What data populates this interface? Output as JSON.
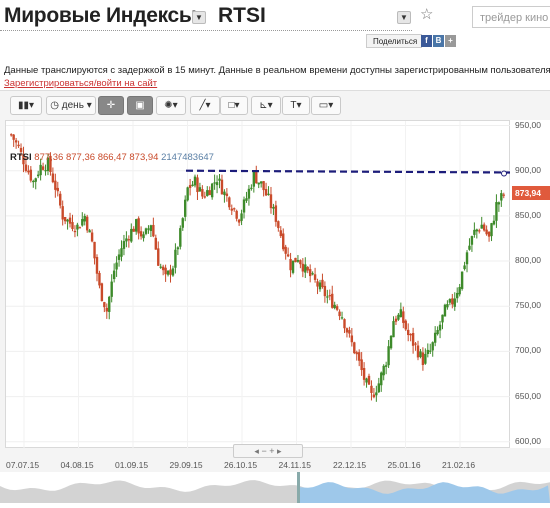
{
  "header": {
    "title": "Мировые Индексы",
    "symbol": "RTSI",
    "search_placeholder": "трейдер кино",
    "share_label": "Поделиться",
    "share_icons": [
      "f",
      "B",
      "+"
    ]
  },
  "notice": {
    "text": "Данные транслируются с задержкой в 15 минут. Данные в реальном времени доступны зарегистрированным пользователям.",
    "link": "Зарегистрироваться/войти на сайт",
    "tail": "."
  },
  "toolbar": {
    "period_label": "день",
    "icons": [
      "candles-icon",
      "clock-icon",
      "crosshair-icon",
      "save-icon",
      "indicators-icon",
      "line-draw-icon",
      "shapes-icon",
      "fibonacci-icon",
      "text-icon",
      "image-icon"
    ]
  },
  "legend": {
    "symbol": "RTSI",
    "open": "877,36",
    "high": "877,36",
    "low": "866,47",
    "close": "873,94",
    "volume": "2147483647"
  },
  "pager": {
    "left": "◂",
    "minus": "−",
    "plus": "+",
    "right": "▸"
  },
  "colors": {
    "up": "#3d8a2a",
    "down": "#c94a2a",
    "trendline": "#1c1c7a",
    "price_tag": "#e05a3c",
    "navigator": "#9ec8ea"
  },
  "chart_data": {
    "type": "candlestick",
    "y_ticks": [
      "950,00",
      "900,00",
      "850,00",
      "800,00",
      "750,00",
      "700,00",
      "650,00",
      "600,00"
    ],
    "x_ticks": [
      "07.07.15",
      "04.08.15",
      "01.09.15",
      "29.09.15",
      "26.10.15",
      "24.11.15",
      "22.12.15",
      "25.01.16",
      "21.02.16"
    ],
    "ylim": [
      592,
      955
    ],
    "current_price": "873,94",
    "trendline": {
      "from": [
        "29.09.15",
        900
      ],
      "to": [
        "end",
        898
      ]
    },
    "close_path": [
      [
        0,
        940
      ],
      [
        3,
        925
      ],
      [
        6,
        905
      ],
      [
        9,
        888
      ],
      [
        12,
        905
      ],
      [
        15,
        908
      ],
      [
        18,
        882
      ],
      [
        21,
        850
      ],
      [
        24,
        842
      ],
      [
        27,
        838
      ],
      [
        30,
        850
      ],
      [
        33,
        820
      ],
      [
        36,
        770
      ],
      [
        39,
        745
      ],
      [
        42,
        790
      ],
      [
        45,
        815
      ],
      [
        48,
        830
      ],
      [
        51,
        840
      ],
      [
        54,
        825
      ],
      [
        57,
        842
      ],
      [
        60,
        800
      ],
      [
        63,
        780
      ],
      [
        66,
        795
      ],
      [
        69,
        830
      ],
      [
        72,
        880
      ],
      [
        75,
        888
      ],
      [
        78,
        872
      ],
      [
        81,
        880
      ],
      [
        84,
        892
      ],
      [
        87,
        875
      ],
      [
        90,
        862
      ],
      [
        93,
        848
      ],
      [
        96,
        870
      ],
      [
        99,
        895
      ],
      [
        102,
        885
      ],
      [
        105,
        868
      ],
      [
        108,
        848
      ],
      [
        111,
        820
      ],
      [
        114,
        795
      ],
      [
        117,
        805
      ],
      [
        120,
        790
      ],
      [
        123,
        780
      ],
      [
        126,
        770
      ],
      [
        129,
        760
      ],
      [
        132,
        752
      ],
      [
        135,
        740
      ],
      [
        138,
        715
      ],
      [
        141,
        695
      ],
      [
        144,
        670
      ],
      [
        147,
        650
      ],
      [
        150,
        665
      ],
      [
        153,
        690
      ],
      [
        156,
        735
      ],
      [
        159,
        740
      ],
      [
        162,
        718
      ],
      [
        165,
        705
      ],
      [
        168,
        690
      ],
      [
        171,
        700
      ],
      [
        174,
        722
      ],
      [
        177,
        745
      ],
      [
        180,
        755
      ],
      [
        183,
        775
      ],
      [
        186,
        810
      ],
      [
        189,
        832
      ],
      [
        192,
        840
      ],
      [
        195,
        825
      ],
      [
        198,
        862
      ],
      [
        201,
        874
      ]
    ]
  }
}
